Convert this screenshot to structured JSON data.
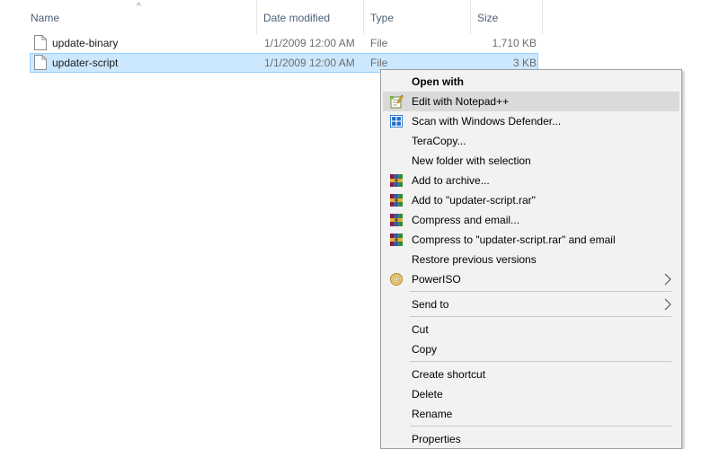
{
  "columns": {
    "name": "Name",
    "date_modified": "Date modified",
    "type": "Type",
    "size": "Size"
  },
  "files": [
    {
      "name": "update-binary",
      "date": "1/1/2009 12:00 AM",
      "type": "File",
      "size": "1,710 KB",
      "selected": false,
      "icon": "file-icon"
    },
    {
      "name": "updater-script",
      "date": "1/1/2009 12:00 AM",
      "type": "File",
      "size": "3 KB",
      "selected": true,
      "icon": "file-icon"
    }
  ],
  "context_menu": {
    "items": [
      {
        "label": "Open with",
        "bold": true
      },
      {
        "label": "Edit with Notepad++",
        "icon": "notepad-plus-plus-icon",
        "highlighted": true
      },
      {
        "label": "Scan with Windows Defender...",
        "icon": "windows-defender-icon"
      },
      {
        "label": "TeraCopy..."
      },
      {
        "label": "New folder with selection"
      },
      {
        "label": "Add to archive...",
        "icon": "winrar-icon"
      },
      {
        "label": "Add to \"updater-script.rar\"",
        "icon": "winrar-icon"
      },
      {
        "label": "Compress and email...",
        "icon": "winrar-icon"
      },
      {
        "label": "Compress to \"updater-script.rar\" and email",
        "icon": "winrar-icon"
      },
      {
        "label": "Restore previous versions"
      },
      {
        "label": "PowerISO",
        "icon": "poweriso-icon",
        "submenu": true
      },
      {
        "label": "Send to",
        "submenu": true
      },
      {
        "label": "Cut"
      },
      {
        "label": "Copy"
      },
      {
        "label": "Create shortcut"
      },
      {
        "label": "Delete"
      },
      {
        "label": "Rename"
      },
      {
        "label": "Properties"
      }
    ]
  },
  "colors": {
    "selection_fill": "#cce8ff",
    "selection_border": "#99d1ff",
    "menu_background": "#f2f2f2",
    "menu_hover": "#dadada",
    "header_text": "#4c607a"
  }
}
